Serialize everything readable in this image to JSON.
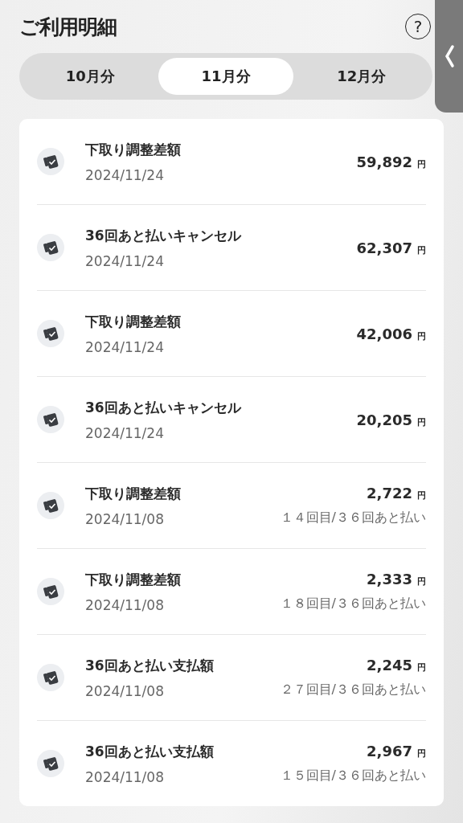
{
  "header": {
    "title": "ご利用明細",
    "help": "?"
  },
  "tabs": [
    {
      "label": "10月分",
      "selected": false
    },
    {
      "label": "11月分",
      "selected": true
    },
    {
      "label": "12月分",
      "selected": false
    }
  ],
  "transactions": [
    {
      "title": "下取り調整差額",
      "date": "2024/11/24",
      "amount": "59,892",
      "unit": "円"
    },
    {
      "title": "36回あと払いキャンセル",
      "date": "2024/11/24",
      "amount": "62,307",
      "unit": "円"
    },
    {
      "title": "下取り調整差額",
      "date": "2024/11/24",
      "amount": "42,006",
      "unit": "円"
    },
    {
      "title": "36回あと払いキャンセル",
      "date": "2024/11/24",
      "amount": "20,205",
      "unit": "円"
    },
    {
      "title": "下取り調整差額",
      "date": "2024/11/08",
      "amount": "2,722",
      "unit": "円",
      "installment": "１４回目/３６回あと払い"
    },
    {
      "title": "下取り調整差額",
      "date": "2024/11/08",
      "amount": "2,333",
      "unit": "円",
      "installment": "１８回目/３６回あと払い"
    },
    {
      "title": "36回あと払い支払額",
      "date": "2024/11/08",
      "amount": "2,245",
      "unit": "円",
      "installment": "２７回目/３６回あと払い"
    },
    {
      "title": "36回あと払い支払額",
      "date": "2024/11/08",
      "amount": "2,967",
      "unit": "円",
      "installment": "１５回目/３６回あと払い"
    }
  ]
}
